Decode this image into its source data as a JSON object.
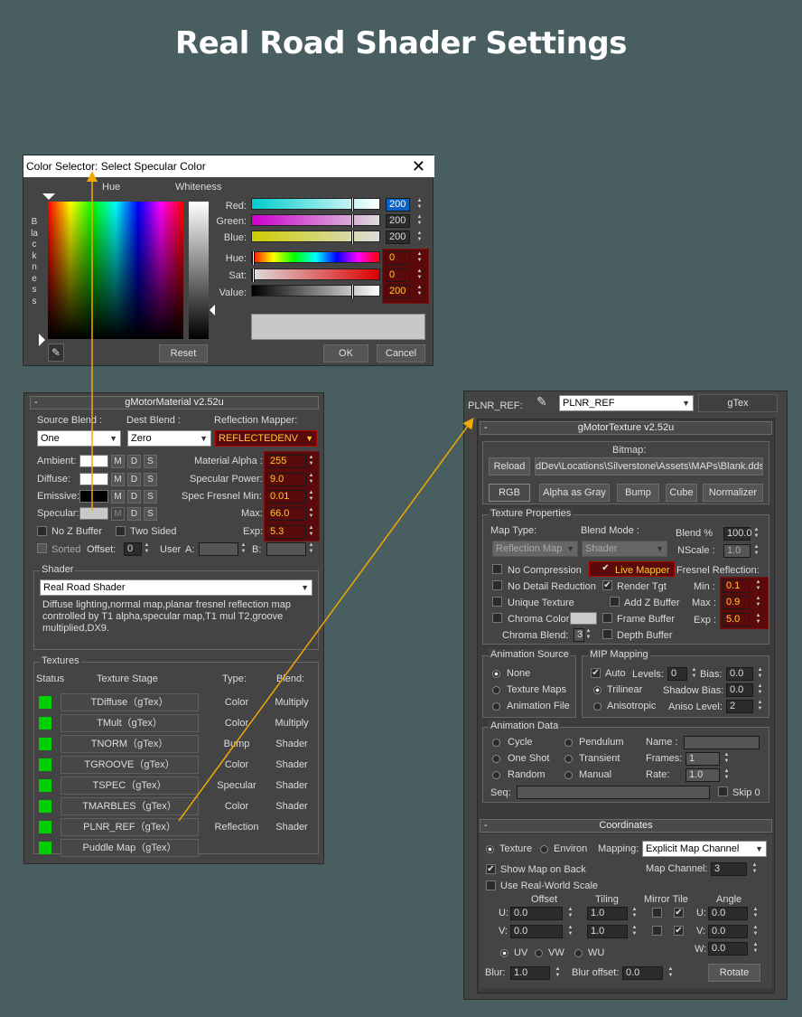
{
  "page_title": "Real Road Shader Settings",
  "color_selector": {
    "title": "Color Selector: Select Specular Color",
    "hue_label": "Hue",
    "whiteness_label": "Whiteness",
    "blackness_label": "Blackness",
    "red_label": "Red:",
    "green_label": "Green:",
    "blue_label": "Blue:",
    "hue_label2": "Hue:",
    "sat_label": "Sat:",
    "value_label": "Value:",
    "red": "200",
    "green": "200",
    "blue": "200",
    "hue": "0",
    "sat": "0",
    "value": "200",
    "reset": "Reset",
    "ok": "OK",
    "cancel": "Cancel",
    "preview_color": "#c8c8c8"
  },
  "gmaterial": {
    "header": "gMotorMaterial v2.52u",
    "source_blend_label": "Source Blend :",
    "dest_blend_label": "Dest Blend :",
    "refl_mapper_label": "Reflection Mapper:",
    "source_blend": "One",
    "dest_blend": "Zero",
    "refl_mapper": "REFLECTEDENV",
    "ambient": "Ambient:",
    "diffuse": "Diffuse:",
    "emissive": "Emissive:",
    "specular": "Specular:",
    "m": "M",
    "d": "D",
    "s": "S",
    "material_alpha_label": "Material Alpha :",
    "material_alpha": "255",
    "specular_power_label": "Specular Power:",
    "specular_power": "9.0",
    "spec_fresnel_label": "Spec Fresnel",
    "min_label": "Min:",
    "spec_min": "0.01",
    "max_label": "Max:",
    "spec_max": "66.0",
    "exp_label": "Exp:",
    "spec_exp": "5.3",
    "no_z_buffer": "No Z Buffer",
    "two_sided": "Two Sided",
    "sorted": "Sorted",
    "offset_label": "Offset:",
    "offset": "0",
    "user_label": "User",
    "a_label": "A:",
    "b_label": "B:",
    "shader_group": "Shader",
    "shader": "Real Road Shader",
    "shader_desc": "Diffuse lighting,normal map,planar fresnel reflection map controlled by T1 alpha,specular map,T1 mul T2,groove multiplied,DX9.",
    "textures_group": "Textures",
    "col_status": "Status",
    "col_stage": "Texture Stage",
    "col_type": "Type:",
    "col_blend": "Blend:",
    "stages": [
      {
        "name": "TDiffuse（gTex）",
        "type": "Color",
        "blend": "Multiply"
      },
      {
        "name": "TMult（gTex）",
        "type": "Color",
        "blend": "Multiply"
      },
      {
        "name": "TNORM（gTex）",
        "type": "Bump",
        "blend": "Shader"
      },
      {
        "name": "TGROOVE（gTex）",
        "type": "Color",
        "blend": "Shader"
      },
      {
        "name": "TSPEC（gTex）",
        "type": "Specular",
        "blend": "Shader"
      },
      {
        "name": "TMARBLES（gTex）",
        "type": "Color",
        "blend": "Shader"
      },
      {
        "name": "PLNR_REF（gTex）",
        "type": "Reflection",
        "blend": "Shader"
      },
      {
        "name": "Puddle Map（gTex）",
        "type": "",
        "blend": ""
      }
    ]
  },
  "gtexture": {
    "plnr_label": "PLNR_REF:",
    "plnr_value": "PLNR_REF",
    "gtex_button": "gTex",
    "header": "gMotorTexture v2.52u",
    "bitmap_label": "Bitmap:",
    "reload": "Reload",
    "bitmap_path": "dDev\\Locations\\Silverstone\\Assets\\MAPs\\Blank.dds",
    "rgb": "RGB",
    "alpha_as_gray": "Alpha as Gray",
    "bump": "Bump",
    "cube": "Cube",
    "normalizer": "Normalizer",
    "tex_props": "Texture Properties",
    "map_type_label": "Map Type:",
    "blend_mode_label": "Blend Mode :",
    "blend_pct_label": "Blend %",
    "map_type": "Reflection Map",
    "blend_mode": "Shader",
    "blend_pct": "100.0",
    "nscale_label": "NScale :",
    "nscale": "1.0",
    "no_compression": "No Compression",
    "live_mapper": "Live Mapper",
    "fresnel_label": "Fresnel Reflection:",
    "no_detail_reduction": "No Detail Reduction",
    "render_tgt": "Render Tgt",
    "min_label": "Min :",
    "fmin": "0.1",
    "unique_texture": "Unique Texture",
    "add_z_buffer": "Add Z Buffer",
    "max_label": "Max :",
    "fmax": "0.9",
    "chroma_color": "Chroma Color:",
    "frame_buffer": "Frame Buffer",
    "exp_label": "Exp :",
    "fexp": "5.0",
    "chroma_blend": "Chroma Blend:",
    "chroma_blend_val": "3",
    "depth_buffer": "Depth Buffer",
    "anim_source": "Animation Source",
    "none": "None",
    "texture_maps": "Texture Maps",
    "animation_file": "Animation File",
    "mip_mapping": "MIP Mapping",
    "auto": "Auto",
    "levels_label": "Levels:",
    "levels": "0",
    "bias_label": "Bias:",
    "bias": "0.0",
    "trilinear": "Trilinear",
    "shadow_bias_label": "Shadow Bias:",
    "shadow_bias": "0.0",
    "anisotropic": "Anisotropic",
    "aniso_level_label": "Aniso Level:",
    "aniso_level": "2",
    "anim_data": "Animation Data",
    "cycle": "Cycle",
    "pendulum": "Pendulum",
    "name_label": "Name :",
    "one_shot": "One Shot",
    "transient": "Transient",
    "frames_label": "Frames:",
    "frames": "1",
    "random": "Random",
    "manual": "Manual",
    "rate_label": "Rate:",
    "rate": "1.0",
    "seq_label": "Seq:",
    "skip0": "Skip 0",
    "coords_header": "Coordinates",
    "texture": "Texture",
    "environ": "Environ",
    "mapping_label": "Mapping:",
    "mapping": "Explicit Map Channel",
    "show_map_on_back": "Show Map on Back",
    "map_channel_label": "Map Channel:",
    "map_channel": "3",
    "use_real_world": "Use Real-World Scale",
    "offset_label": "Offset",
    "tiling_label": "Tiling",
    "mirror_tile_label": "Mirror Tile",
    "angle_label": "Angle",
    "u_label": "U:",
    "v_label": "V:",
    "w_label": "W:",
    "u_offset": "0.0",
    "v_offset": "0.0",
    "u_tiling": "1.0",
    "v_tiling": "1.0",
    "u_angle": "0.0",
    "v_angle": "0.0",
    "w_angle": "0.0",
    "uv": "UV",
    "vw": "VW",
    "wu": "WU",
    "blur_label": "Blur:",
    "blur": "1.0",
    "blur_offset_label": "Blur offset:",
    "blur_offset": "0.0",
    "rotate": "Rotate"
  }
}
